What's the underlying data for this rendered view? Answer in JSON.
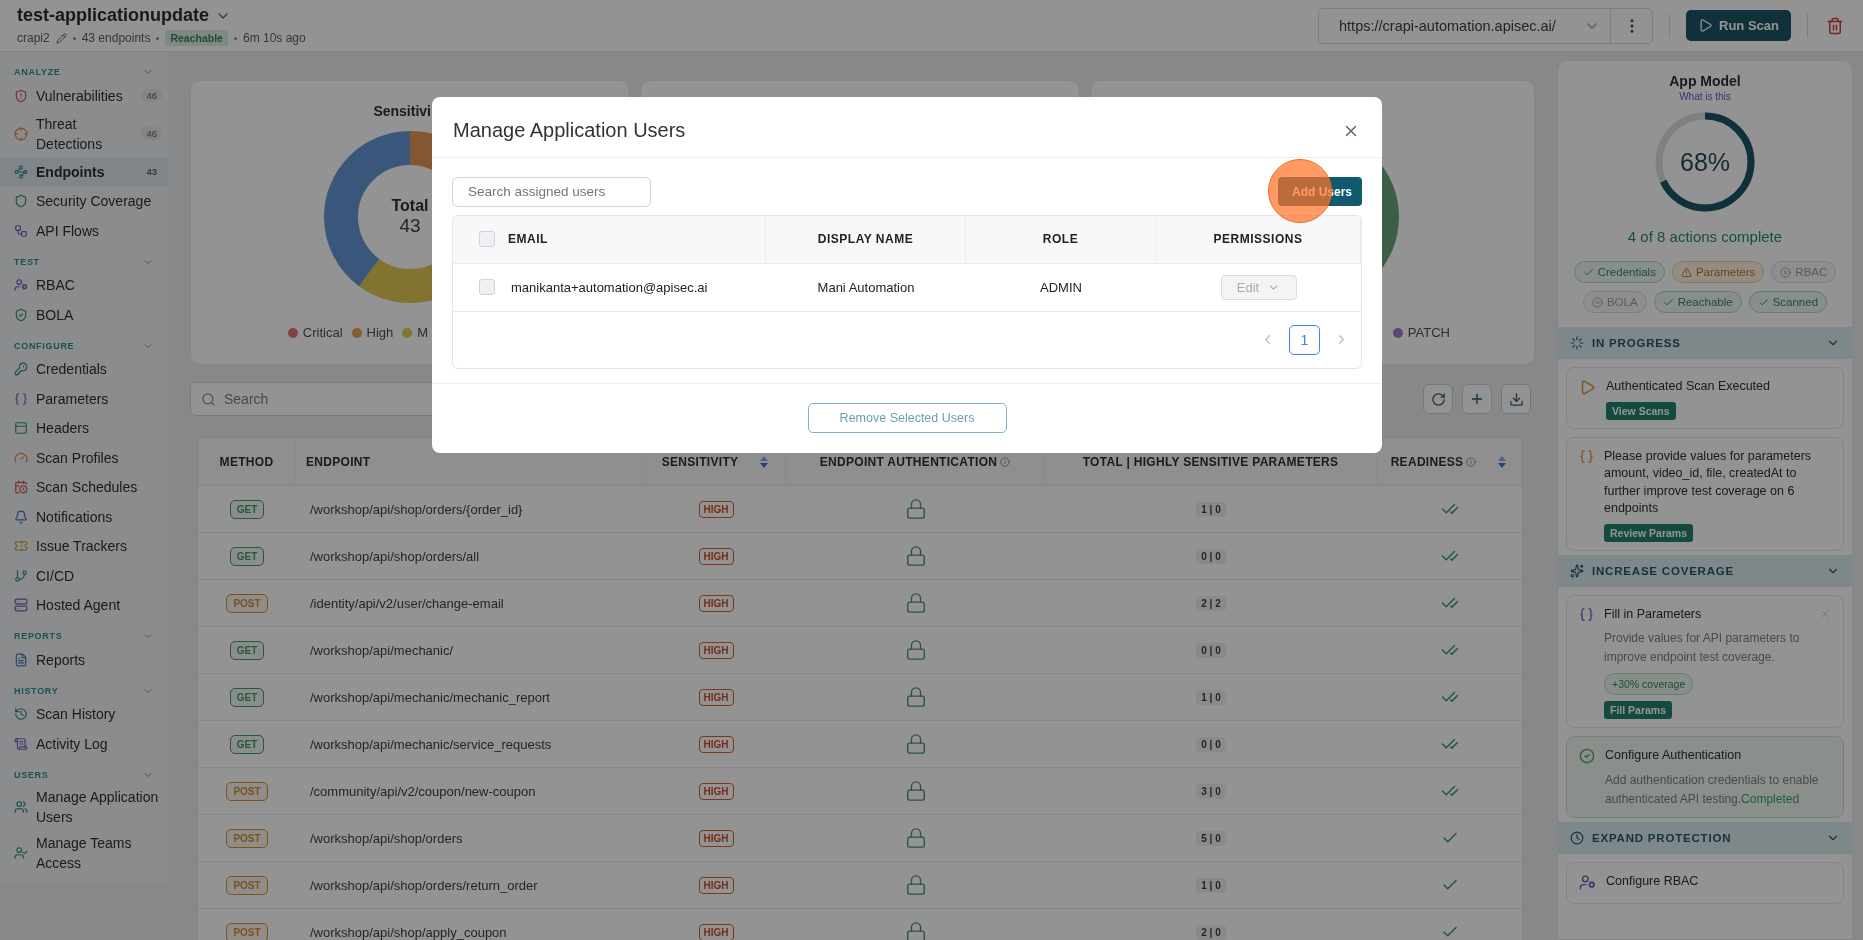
{
  "header": {
    "title": "test-applicationupdate",
    "project": "crapi2",
    "endpoints": "43 endpoints",
    "status": "Reachable",
    "updated": "6m 10s ago",
    "url": "https://crapi-automation.apisec.ai/",
    "run_button": "Run Scan"
  },
  "sidebar": {
    "sections": [
      {
        "title": "ANALYZE",
        "expanded": true,
        "items": [
          {
            "label": "Vulnerabilities",
            "count": "46",
            "selected": false
          },
          {
            "label": "Threat Detections",
            "count": "46",
            "selected": false
          },
          {
            "label": "Endpoints",
            "count": "43",
            "selected": true
          },
          {
            "label": "Security Coverage",
            "selected": false
          },
          {
            "label": "API Flows",
            "selected": false
          }
        ]
      },
      {
        "title": "TEST",
        "expanded": true,
        "items": [
          {
            "label": "RBAC",
            "selected": false
          },
          {
            "label": "BOLA",
            "selected": false
          }
        ]
      },
      {
        "title": "CONFIGURE",
        "expanded": true,
        "items": [
          {
            "label": "Credentials",
            "selected": false
          },
          {
            "label": "Parameters",
            "selected": false
          },
          {
            "label": "Headers",
            "selected": false
          },
          {
            "label": "Scan Profiles",
            "selected": false
          },
          {
            "label": "Scan Schedules",
            "selected": false
          },
          {
            "label": "Notifications",
            "selected": false
          },
          {
            "label": "Issue Trackers",
            "selected": false
          },
          {
            "label": "CI/CD",
            "selected": false
          },
          {
            "label": "Hosted Agent",
            "selected": false
          }
        ]
      },
      {
        "title": "REPORTS",
        "expanded": true,
        "items": [
          {
            "label": "Reports",
            "selected": false
          }
        ]
      },
      {
        "title": "HISTORY",
        "expanded": true,
        "items": [
          {
            "label": "Scan History",
            "selected": false
          },
          {
            "label": "Activity Log",
            "selected": false
          }
        ]
      },
      {
        "title": "USERS",
        "expanded": true,
        "items": [
          {
            "label": "Manage Application Users",
            "selected": false
          },
          {
            "label": "Manage Teams Access",
            "selected": false
          }
        ]
      }
    ]
  },
  "charts": [
    {
      "kind": "sensitivity",
      "title": "Sensitivi",
      "total_label": "Total",
      "total": "43",
      "legend": [
        {
          "label": "Critical",
          "color": "#824242"
        },
        {
          "label": "High",
          "color": "#865c32"
        },
        {
          "label": "M",
          "color": "#837430"
        }
      ]
    },
    {
      "kind": "blank"
    },
    {
      "kind": "methods",
      "legend": [
        {
          "label": "PATCH",
          "color": "#5c4776"
        }
      ]
    }
  ],
  "search": {
    "placeholder": "Search"
  },
  "table": {
    "columns": [
      {
        "label": "METHOD",
        "sortable": false,
        "info": false
      },
      {
        "label": "ENDPOINT",
        "sortable": false,
        "info": false
      },
      {
        "label": "SENSITIVITY",
        "sortable": true,
        "info": false
      },
      {
        "label": "ENDPOINT AUTHENTICATION",
        "sortable": false,
        "info": true
      },
      {
        "label": "TOTAL | HIGHLY SENSITIVE PARAMETERS",
        "sortable": false,
        "info": false
      },
      {
        "label": "READINESS",
        "sortable": true,
        "info": true
      }
    ],
    "rows": [
      {
        "method": "GET",
        "kind": "get",
        "endpoint": "/workshop/api/shop/orders/{order_id}",
        "sensitivity": "HIGH",
        "parameters": "1 | 0",
        "fully_ready": true
      },
      {
        "method": "GET",
        "kind": "get",
        "endpoint": "/workshop/api/shop/orders/all",
        "sensitivity": "HIGH",
        "parameters": "0 | 0",
        "fully_ready": true
      },
      {
        "method": "POST",
        "kind": "post",
        "endpoint": "/identity/api/v2/user/change-email",
        "sensitivity": "HIGH",
        "parameters": "2 | 2",
        "fully_ready": true
      },
      {
        "method": "GET",
        "kind": "get",
        "endpoint": "/workshop/api/mechanic/",
        "sensitivity": "HIGH",
        "parameters": "0 | 0",
        "fully_ready": true
      },
      {
        "method": "GET",
        "kind": "get",
        "endpoint": "/workshop/api/mechanic/mechanic_report",
        "sensitivity": "HIGH",
        "parameters": "1 | 0",
        "fully_ready": true
      },
      {
        "method": "GET",
        "kind": "get",
        "endpoint": "/workshop/api/mechanic/service_requests",
        "sensitivity": "HIGH",
        "parameters": "0 | 0",
        "fully_ready": true
      },
      {
        "method": "POST",
        "kind": "post",
        "endpoint": "/community/api/v2/coupon/new-coupon",
        "sensitivity": "HIGH",
        "parameters": "3 | 0",
        "fully_ready": true
      },
      {
        "method": "POST",
        "kind": "post",
        "endpoint": "/workshop/api/shop/orders",
        "sensitivity": "HIGH",
        "parameters": "5 | 0",
        "fully_ready": false
      },
      {
        "method": "POST",
        "kind": "post",
        "endpoint": "/workshop/api/shop/orders/return_order",
        "sensitivity": "HIGH",
        "parameters": "1 | 0",
        "fully_ready": false
      },
      {
        "method": "POST",
        "kind": "post",
        "endpoint": "/workshop/api/shop/apply_coupon",
        "sensitivity": "HIGH",
        "parameters": "2 | 0",
        "fully_ready": false
      }
    ]
  },
  "app_model": {
    "title": "App Model",
    "help_link": "What is this",
    "level": 0.68,
    "percent": "68%",
    "summary": "4 of 8 actions complete",
    "chips": [
      {
        "label": "Credentials",
        "kind": "done"
      },
      {
        "label": "Parameters",
        "kind": "warning"
      },
      {
        "label": "RBAC",
        "kind": "missing"
      },
      {
        "label": "BOLA",
        "kind": "missing"
      },
      {
        "label": "Reachable",
        "kind": "done"
      },
      {
        "label": "Scanned",
        "kind": "done"
      }
    ]
  },
  "guide_sections": [
    {
      "title": "IN PROGRESS",
      "expanded": true,
      "cards": [
        {
          "kind": "scan",
          "title": "Authenticated Scan Executed",
          "button": "View Scans",
          "completed": false,
          "dismissible": false
        },
        {
          "kind": "params",
          "title": "Please provide values for parameters amount, video_id, file, createdAt to further improve test coverage on 6 endpoints",
          "button": "Review Params",
          "completed": false,
          "dismissible": false
        }
      ]
    },
    {
      "title": "INCREASE COVERAGE",
      "expanded": true,
      "cards": [
        {
          "kind": "fill",
          "title": "Fill in Parameters",
          "description": "Provide values for API parameters to improve endpoint test coverage.",
          "badge": "+30% coverage",
          "button": "Fill Params",
          "completed": false,
          "dismissible": true
        },
        {
          "kind": "auth",
          "title": "Configure Authentication",
          "description": "Add authentication credentials to enable authenticated API testing.",
          "status": "Completed",
          "completed": true,
          "dismissible": false
        }
      ]
    },
    {
      "title": "EXPAND PROTECTION",
      "expanded": true,
      "cards": [
        {
          "kind": "rbac",
          "title": "Configure RBAC",
          "completed": false,
          "dismissible": false
        }
      ]
    }
  ],
  "modal": {
    "title": "Manage Application Users",
    "search_placeholder": "Search assigned users",
    "add_button": "Add Users",
    "select_all_checked": false,
    "columns": [
      "EMAIL",
      "DISPLAY NAME",
      "ROLE",
      "PERMISSIONS"
    ],
    "rows": [
      {
        "checked": false,
        "email": "manikanta+automation@apisec.ai",
        "display_name": "Mani Automation",
        "role": "ADMIN",
        "permission": "Edit",
        "permission_disabled": true
      }
    ],
    "pages": [
      {
        "label": "1",
        "selected": true
      }
    ],
    "remove_button": "Remove Selected Users"
  }
}
